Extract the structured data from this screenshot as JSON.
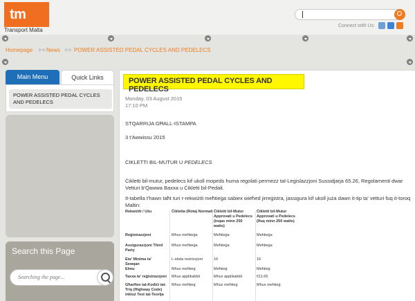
{
  "header": {
    "logo_text": "tm",
    "logo_caption": "Transport Malta",
    "search_value": "",
    "connect_label": "Connect with Us:",
    "social_icons": [
      "email-icon",
      "rss-icon",
      "feed-icon"
    ],
    "accent_color": "#f06e1f"
  },
  "breadcrumb": [
    "Homepage",
    "News",
    "POWER ASSISTED PEDAL CYCLES AND PEDELECS"
  ],
  "sidebar": {
    "tabs": [
      "Main Menu",
      "Quick Links"
    ],
    "menu_item": "POWER ASSISTED PEDAL CYCLES AND PEDELECS",
    "search_title": "Search this Page",
    "search_placeholder": "Searching the page..."
  },
  "article": {
    "title": "POWER ASSISTED PEDAL CYCLES AND PEDELECS",
    "date": "Monday, 03 August 2015",
    "time": "17:10 PM",
    "press_release": "STQARRIJA GĦALL-ISTAMPA",
    "release_date": "3 t'Awwissu 2015",
    "heading_plain": "ĊIKLETTI BIL-MUTUR U ",
    "heading_em": "PEDELECS",
    "para1": "Ċikletti bil-mutur, pedelecs kif ukoll mopeds huma regolati permezz tal-Leġislazzjoni Sussidjarja 65.26, Regolamenti dwar Vetturi b'Qawwa Baxxa u Ċikletti bil-Pedali.",
    "para2": "It-tabella t'hawn taħt turi r-rekwiżiti meħtieġa sabiex wieħed jirreġistra, jassigura kif ukoll juża dawn it-tip ta' vetturi fuq it-toroq Maltin:",
    "table": {
      "headers": [
        "Rekwiżiti / Użu",
        "Ċikletta (Rota) Normali",
        "Ċikletti bil-Mutur Approvati u Pedelecs (inqas minn 250 watts)",
        "Ċikletti bil-Mutur Approvati u Pedelecs (Ifuq minn 250 watts)"
      ],
      "rows": [
        [
          "Reġistrazzjoni",
          "Mhux meħtieġa",
          "Meħtieġa",
          "Meħtieġa"
        ],
        [
          "Assigurazzjoni Third Party",
          "Mhux meħtieġa",
          "Meħtieġa",
          "Meħtieġa"
        ],
        [
          "Eta' Minima ta' Sewqan",
          "L-ebda restrizzjoni",
          "16",
          "16"
        ],
        [
          "Elmu",
          "Mhux meħtieġ",
          "Meħtieġ",
          "Meħtieġ"
        ],
        [
          "Taxxa ta' reġistrazzjoni",
          "Mhux applikabbli",
          "Mhux applikabbli",
          "€11.65"
        ],
        [
          "Għarfien tal-Kodiċi tat-Triq (Highway Code) inkluż Test tat-Teorija",
          "Mhux meħtieġ",
          "Mhux meħtieġ",
          "Mhux meħtieġ"
        ]
      ]
    }
  }
}
